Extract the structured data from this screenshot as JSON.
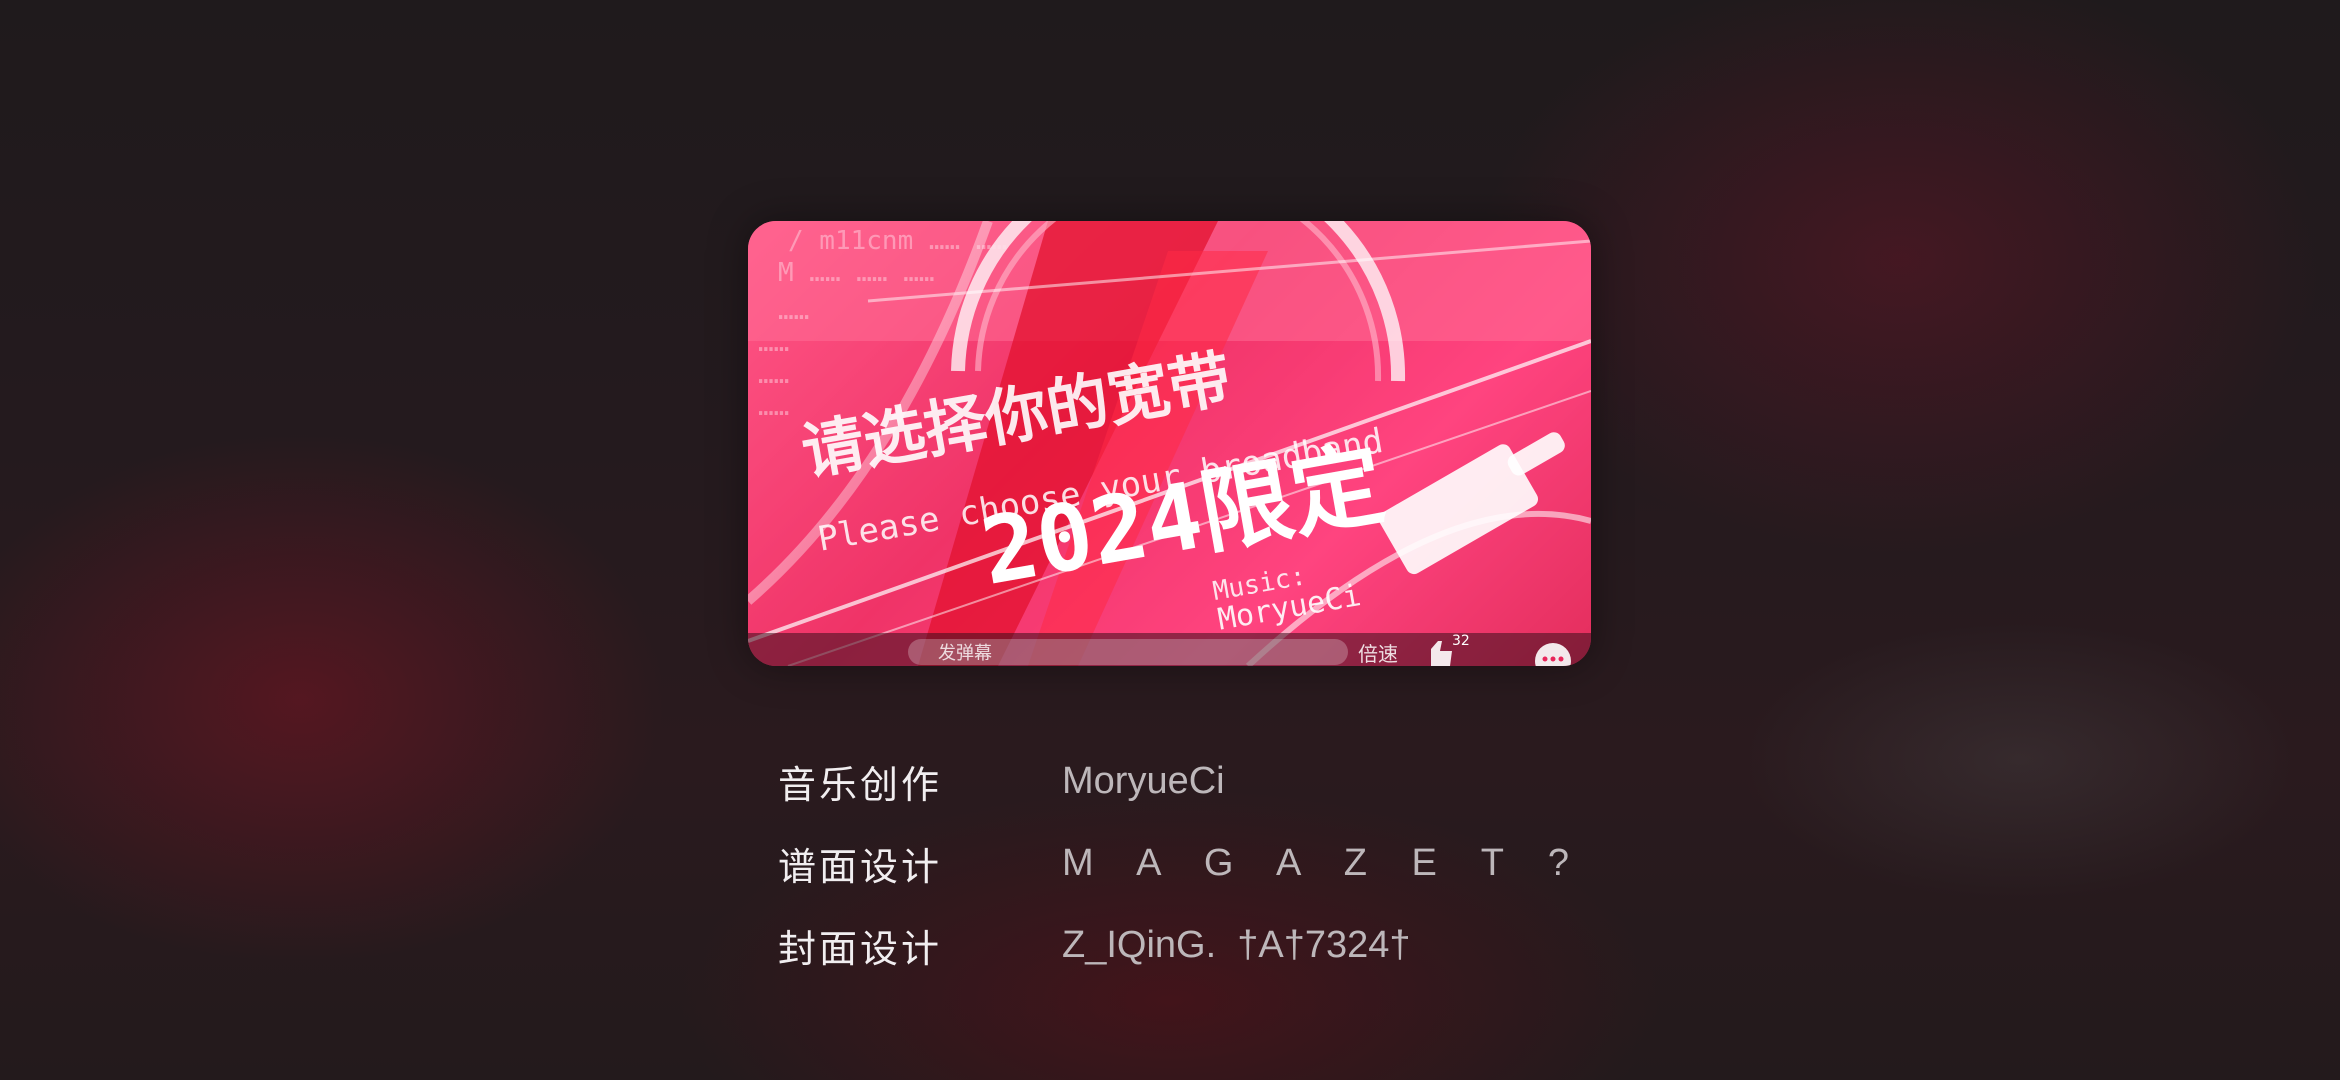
{
  "cover": {
    "overlay_texts": {
      "banner_cn": "请选择你的宽带",
      "banner_en": "Please choose your broadband",
      "edition": "2024限定",
      "music_label": "Music:",
      "music_artist": "MoryueCi",
      "danmaku_placeholder": "发弹幕",
      "speed_label": "倍速",
      "like_count": "32"
    },
    "colors": {
      "primary": "#e8265a",
      "light": "#ff7aa2"
    }
  },
  "credits": [
    {
      "label": "音乐创作",
      "value": "MoryueCi"
    },
    {
      "label": "谱面设计",
      "value": "M A G A Z E T ?"
    },
    {
      "label": "封面设计",
      "value": "Z_IQinG.  †A†7324†"
    }
  ]
}
